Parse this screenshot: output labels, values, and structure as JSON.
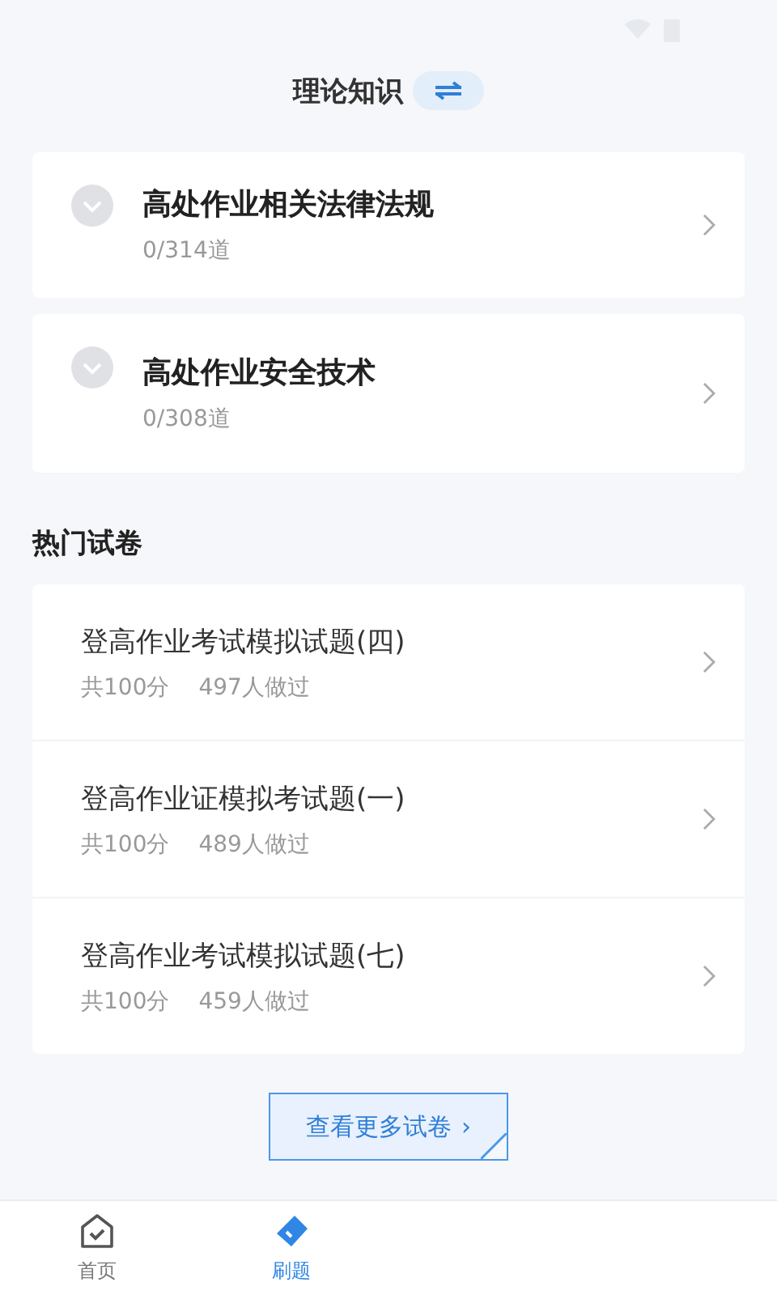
{
  "header": {
    "title": "理论知识"
  },
  "subjects": [
    {
      "title": "高处作业相关法律法规",
      "progress": "0/314道"
    },
    {
      "title": "高处作业安全技术",
      "progress": "0/308道"
    }
  ],
  "hot_papers": {
    "heading": "热门试卷",
    "items": [
      {
        "title": "登高作业考试模拟试题(四)",
        "score": "共100分",
        "count": "497人做过"
      },
      {
        "title": "登高作业证模拟考试题(一)",
        "score": "共100分",
        "count": "489人做过"
      },
      {
        "title": "登高作业考试模拟试题(七)",
        "score": "共100分",
        "count": "459人做过"
      }
    ],
    "more_button": {
      "label": "查看更多试卷",
      "arrow": "›"
    }
  },
  "tab_bar": [
    {
      "label": "首页",
      "kind": "home",
      "selected": false
    },
    {
      "label": "刷题",
      "kind": "tag",
      "selected": true
    }
  ]
}
